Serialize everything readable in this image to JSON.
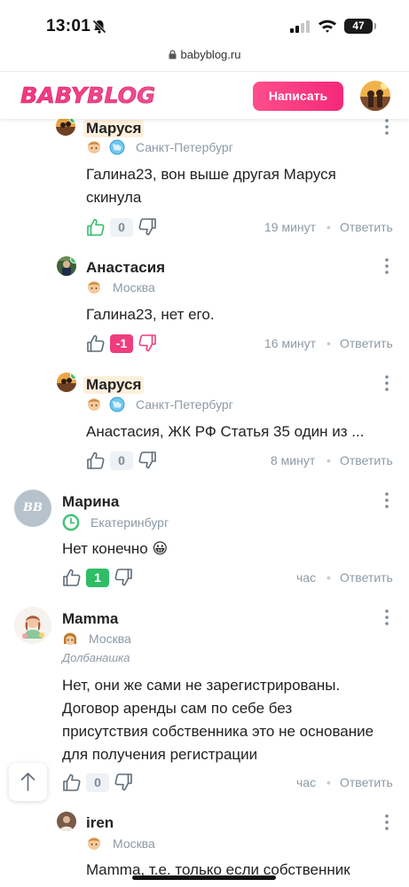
{
  "status_bar": {
    "time": "13:01",
    "battery": "47"
  },
  "url_bar": {
    "domain": "babyblog.ru"
  },
  "header": {
    "logo_text": "BABYBLOG",
    "write_button": "Написать"
  },
  "colors": {
    "brand_pink": "#f4287a",
    "positive": "#2fbd66",
    "negative": "#ef3d7e",
    "muted": "#8d99a6"
  },
  "reply_label": "Ответить",
  "separator": "•",
  "comments": [
    {
      "author": "Маруся",
      "city": "Санкт-Петербург",
      "text": [
        "Галина23, вон выше другая Маруся",
        "скинула"
      ],
      "votes": "0",
      "time": "19 минут",
      "liked": true
    },
    {
      "author": "Анастасия",
      "city": "Москва",
      "text": [
        "Галина23, нет его."
      ],
      "votes": "-1",
      "time": "16 минут",
      "disliked": true
    },
    {
      "author": "Маруся",
      "city": "Санкт-Петербург",
      "text": [
        "Анастасия, ЖК РФ Статья 35 один из ..."
      ],
      "votes": "0",
      "time": "8 минут"
    },
    {
      "author": "Марина",
      "avatar_initials": "ВВ",
      "city": "Екатеринбург",
      "text": [
        "Нет конечно 😀"
      ],
      "votes": "1",
      "time": "час"
    },
    {
      "author": "Mamma",
      "city": "Москва",
      "signature": "Долбанашка",
      "text": [
        "Нет, они же сами не зарегистрированы.",
        "Договор аренды сам по себе без",
        "присутствия собственника это не основание",
        "для получения регистрации"
      ],
      "votes": "0",
      "time": "час"
    },
    {
      "author": "iren",
      "city": "Москва",
      "text": [
        "Mamma, т.е. только если собственник"
      ]
    }
  ]
}
